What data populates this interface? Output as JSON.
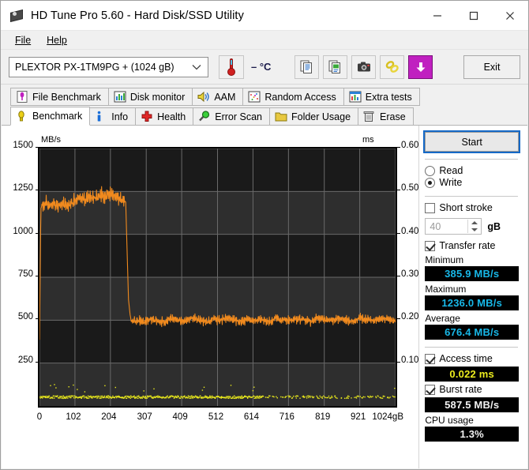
{
  "window": {
    "title": "HD Tune Pro 5.60 - Hard Disk/SSD Utility",
    "icon": "hdtune-disk-icon",
    "minimize": "minimize-icon",
    "maximize": "maximize-icon",
    "close": "close-icon"
  },
  "menu": {
    "items": [
      {
        "label": "File",
        "mnemonic": "F"
      },
      {
        "label": "Help",
        "mnemonic": "H"
      }
    ]
  },
  "toolbar": {
    "drive_selected": "PLEXTOR PX-1TM9PG + (1024 gB)",
    "drive_chevron": "chevron-down-icon",
    "temperature": "– °C",
    "temperature_icon": "thermometer-icon",
    "icons": [
      "copy-document-icon",
      "copy-image-icon",
      "screenshot-camera-icon",
      "benchmark-chain-icon",
      "download-arrow-icon"
    ],
    "exit_label": "Exit"
  },
  "tabs": {
    "row1": [
      {
        "label": "File Benchmark",
        "icon": "file-benchmark-icon",
        "active": false
      },
      {
        "label": "Disk monitor",
        "icon": "disk-monitor-icon",
        "active": false
      },
      {
        "label": "AAM",
        "icon": "aam-speaker-icon",
        "active": false
      },
      {
        "label": "Random Access",
        "icon": "random-access-icon",
        "active": false
      },
      {
        "label": "Extra tests",
        "icon": "extra-tests-icon",
        "active": false
      }
    ],
    "row2": [
      {
        "label": "Benchmark",
        "icon": "benchmark-bulb-icon",
        "active": true
      },
      {
        "label": "Info",
        "icon": "info-icon",
        "active": false
      },
      {
        "label": "Health",
        "icon": "health-cross-icon",
        "active": false
      },
      {
        "label": "Error Scan",
        "icon": "error-scan-magnifier-icon",
        "active": false
      },
      {
        "label": "Folder Usage",
        "icon": "folder-usage-icon",
        "active": false
      },
      {
        "label": "Erase",
        "icon": "erase-trash-icon",
        "active": false
      }
    ]
  },
  "panel": {
    "start_label": "Start",
    "mode_read": "Read",
    "mode_write": "Write",
    "mode_selected": "Write",
    "short_stroke_label": "Short stroke",
    "short_stroke_checked": false,
    "short_stroke_value": "40",
    "short_stroke_unit": "gB",
    "transfer_rate_label": "Transfer rate",
    "transfer_rate_checked": true,
    "minimum_label": "Minimum",
    "minimum_value": "385.9 MB/s",
    "maximum_label": "Maximum",
    "maximum_value": "1236.0 MB/s",
    "average_label": "Average",
    "average_value": "676.4 MB/s",
    "access_time_label": "Access time",
    "access_time_checked": true,
    "access_time_value": "0.022 ms",
    "burst_rate_label": "Burst rate",
    "burst_rate_checked": true,
    "burst_rate_value": "587.5 MB/s",
    "cpu_usage_label": "CPU usage",
    "cpu_usage_value": "1.3%"
  },
  "colors": {
    "transfer_curve": "#f08a1e",
    "access_dots": "#e8e81c",
    "plot_background": "#1a1a1a",
    "grid": "#6a6a6a",
    "lcd_cyan": "#18b8e8",
    "lcd_yellow": "#ecec1e",
    "accent_blue": "#1569c7"
  },
  "chart_data": {
    "type": "line",
    "title": "",
    "xlabel": "gB",
    "ylabel": "MB/s",
    "y2label": "ms",
    "xlim": [
      0,
      1024
    ],
    "ylim": [
      0,
      1500
    ],
    "y2lim": [
      0,
      0.6
    ],
    "grid": true,
    "legend": "none",
    "xticks": [
      0,
      102,
      204,
      307,
      409,
      512,
      614,
      716,
      819,
      921,
      1024
    ],
    "xtick_labels": [
      "0",
      "102",
      "204",
      "307",
      "409",
      "512",
      "614",
      "716",
      "819",
      "921",
      "1024gB"
    ],
    "yticks": [
      250,
      500,
      750,
      1000,
      1250,
      1500
    ],
    "ytick_labels": [
      "250",
      "500",
      "750",
      "1000",
      "1250",
      "1500"
    ],
    "y2ticks": [
      0.1,
      0.2,
      0.3,
      0.4,
      0.5,
      0.6
    ],
    "y2tick_labels": [
      "0.10",
      "0.20",
      "0.30",
      "0.40",
      "0.50",
      "0.60"
    ],
    "series": [
      {
        "name": "Transfer rate",
        "axis": "left",
        "unit": "MB/s",
        "color": "#f08a1e",
        "description": "Write transfer rate: fast SLC-cache plateau near 1150-1240 MB/s until about 250 gB, then a sharp drop to a steady ~500 MB/s plateau for the remainder of the drive.",
        "x": [
          0,
          4,
          8,
          14,
          20,
          30,
          40,
          55,
          70,
          85,
          100,
          115,
          130,
          145,
          160,
          175,
          190,
          205,
          220,
          235,
          248,
          252,
          256,
          262,
          270,
          285,
          300,
          320,
          340,
          360,
          380,
          400,
          420,
          440,
          460,
          480,
          500,
          520,
          540,
          560,
          580,
          600,
          620,
          640,
          660,
          680,
          700,
          720,
          740,
          760,
          780,
          800,
          820,
          840,
          860,
          880,
          900,
          920,
          940,
          960,
          980,
          1000,
          1015,
          1024
        ],
        "y": [
          386,
          1150,
          1170,
          1160,
          1185,
          1160,
          1175,
          1165,
          1180,
          1170,
          1195,
          1215,
          1205,
          1225,
          1210,
          1230,
          1218,
          1236,
          1220,
          1205,
          1190,
          900,
          620,
          505,
          495,
          500,
          490,
          508,
          498,
          486,
          512,
          500,
          494,
          516,
          502,
          488,
          506,
          498,
          514,
          500,
          492,
          510,
          499,
          504,
          487,
          512,
          500,
          495,
          508,
          501,
          490,
          513,
          502,
          496,
          509,
          500,
          493,
          511,
          503,
          497,
          505,
          512,
          500,
          496
        ]
      },
      {
        "name": "Access time",
        "axis": "right",
        "unit": "ms",
        "color": "#e8e81c",
        "description": "Access-time samples clustered along the bottom, averaging 0.022 ms with sparse outliers up to about 0.04 ms.",
        "mean": 0.022
      }
    ],
    "summary": {
      "minimum_mbs": 385.9,
      "maximum_mbs": 1236.0,
      "average_mbs": 676.4,
      "access_time_ms": 0.022,
      "burst_rate_mbs": 587.5,
      "cpu_usage_percent": 1.3
    }
  }
}
